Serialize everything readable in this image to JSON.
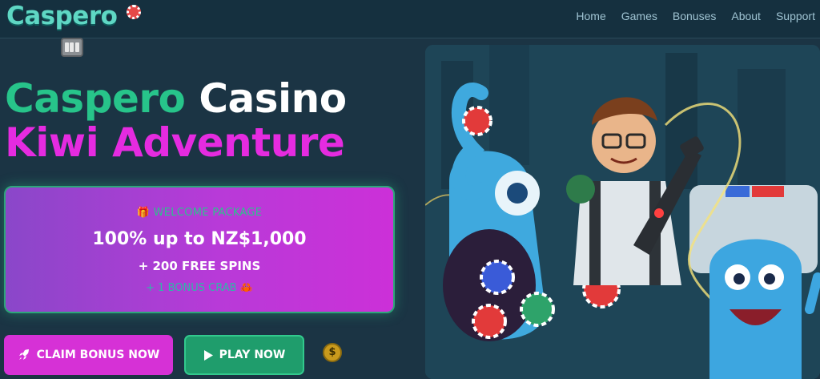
{
  "brand": {
    "logo_text": "Caspero"
  },
  "nav": {
    "items": [
      "Home",
      "Games",
      "Bonuses",
      "About",
      "Support"
    ]
  },
  "hero": {
    "title_line1_part1": "Caspero",
    "title_line1_part2": "Casino",
    "title_line2": "Kiwi Adventure"
  },
  "promo": {
    "welcome_label": "WELCOME PACKAGE",
    "amount": "100% up to NZ$1,000",
    "free_spins": "+ 200 FREE SPINS",
    "bonus_crab": "+ 1 BONUS CRAB"
  },
  "buttons": {
    "claim_label": "CLAIM BONUS NOW",
    "play_label": "PLAY NOW"
  },
  "icons": {
    "gift": "gift-icon",
    "crab": "crab-icon",
    "rocket": "rocket-icon",
    "play": "play-icon",
    "coin": "dollar-coin-icon",
    "slot": "slot-machine-icon"
  },
  "colors": {
    "background": "#1b3444",
    "title_green": "#27c48a",
    "title_magenta": "#e52be0",
    "claim_button": "#d631d6",
    "play_button": "#1f9d6c"
  }
}
